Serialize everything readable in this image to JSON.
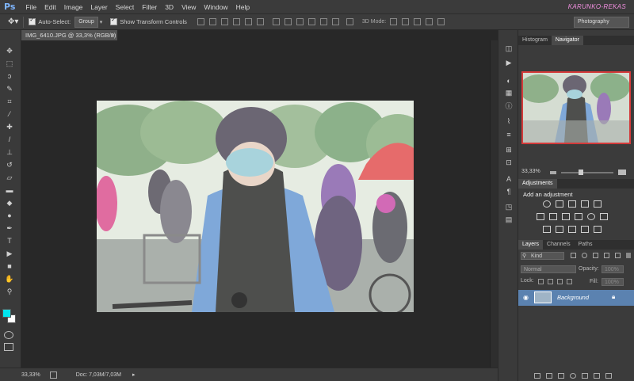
{
  "app": {
    "logo": "Ps",
    "brand_watermark": "KARUNKO-REKAS"
  },
  "menu": [
    "File",
    "Edit",
    "Image",
    "Layer",
    "Select",
    "Filter",
    "3D",
    "View",
    "Window",
    "Help"
  ],
  "options": {
    "auto_select_label": "Auto-Select:",
    "auto_select_value": "Group",
    "show_transform_label": "Show Transform Controls",
    "mode_3d_label": "3D Mode:",
    "workspace": "Photography"
  },
  "document": {
    "tab_title": "IMG_6410.JPG @ 33,3% (RGB/8)",
    "close_glyph": "×"
  },
  "status": {
    "zoom": "33,33%",
    "doc_info": "Doc: 7,03M/7,03M"
  },
  "navigator": {
    "tabs": [
      "Histogram",
      "Navigator"
    ],
    "active_tab": "Navigator",
    "zoom": "33,33%"
  },
  "adjustments": {
    "tab": "Adjustments",
    "heading": "Add an adjustment"
  },
  "layers": {
    "tabs": [
      "Layers",
      "Channels",
      "Paths"
    ],
    "filter_kind": "Kind",
    "blend_mode": "Normal",
    "opacity_label": "Opacity:",
    "opacity_value": "100%",
    "lock_label": "Lock:",
    "fill_label": "Fill:",
    "fill_value": "100%",
    "items": [
      {
        "name": "Background"
      }
    ]
  },
  "colors": {
    "foreground": "#00e5ee",
    "background": "#ffffff",
    "accent_layer": "#5b82b0"
  }
}
